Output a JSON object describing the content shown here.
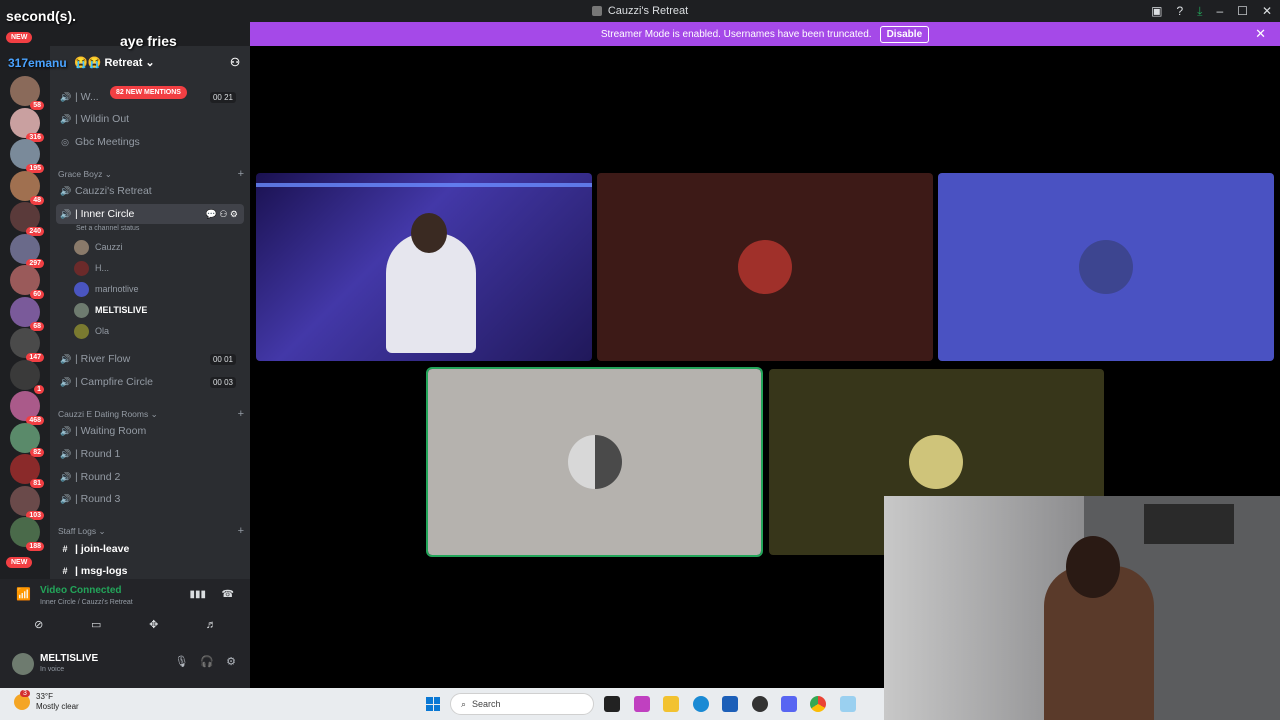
{
  "window": {
    "title": "Cauzzi's Retreat"
  },
  "overlay": {
    "top_text": "second(s).",
    "chat_message": "aye fries",
    "chat_user": "317emanu",
    "server_header_emoji": "😭😭"
  },
  "streamer_banner": {
    "text": "Streamer Mode is enabled. Usernames have been truncated.",
    "button": "Disable"
  },
  "server": {
    "name": "Retreat",
    "mentions_pill": "82 NEW MENTIONS",
    "badges": [
      "58",
      "316",
      "195",
      "48",
      "240",
      "297",
      "60",
      "68",
      "147",
      "1",
      "468",
      "82",
      "81",
      "103",
      "188"
    ],
    "new_label": "NEW"
  },
  "channels": {
    "top": [
      {
        "name": "| W...",
        "counts": [
          "00",
          "21"
        ]
      },
      {
        "name": "| Wildin Out"
      },
      {
        "name": "Gbc Meetings"
      }
    ],
    "grace_boyz": {
      "label": "Grace Boyz",
      "items": [
        {
          "name": "Cauzzi's Retreat"
        },
        {
          "name": "| Inner Circle",
          "status": "Set a channel status"
        }
      ],
      "users": [
        "Cauzzi",
        "H...",
        "marlnotlive",
        "MELTISLIVE",
        "Ola"
      ],
      "after": [
        {
          "name": "| River Flow",
          "counts": [
            "00",
            "01"
          ]
        },
        {
          "name": "| Campfire Circle",
          "counts": [
            "00",
            "03"
          ]
        }
      ]
    },
    "dating": {
      "label": "Cauzzi E Dating Rooms",
      "items": [
        "| Waiting Room",
        "| Round 1",
        "| Round 2",
        "| Round 3"
      ]
    },
    "staff": {
      "label": "Staff Logs",
      "items": [
        "| join-leave",
        "| msg-logs"
      ]
    }
  },
  "voice": {
    "title": "Video Connected",
    "subtitle": "Inner Circle / Cauzzi's Retreat"
  },
  "user_panel": {
    "name": "MELTISLIVE",
    "status": "In voice"
  },
  "taskbar": {
    "temp": "33°F",
    "weather": "Mostly clear",
    "search_placeholder": "Search",
    "notification_count": "3"
  },
  "colors": {
    "accent": "#a549e8",
    "green": "#23a55a",
    "danger": "#f23f43"
  }
}
